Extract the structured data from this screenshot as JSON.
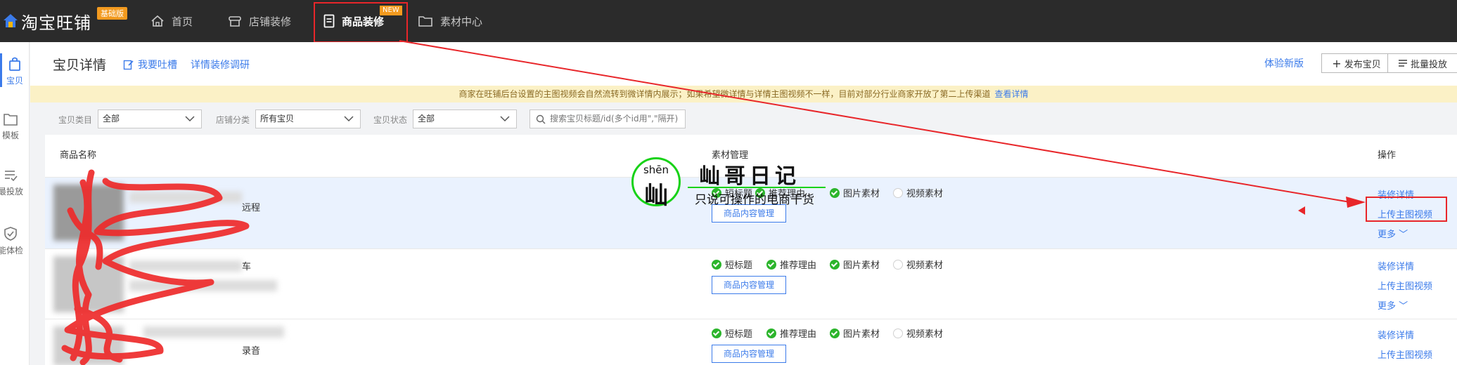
{
  "topnav": {
    "logo_text": "淘宝旺铺",
    "logo_badge": "基础版",
    "items": [
      {
        "label": "首页"
      },
      {
        "label": "店铺装修"
      },
      {
        "label": "商品装修",
        "badge": "NEW"
      },
      {
        "label": "素材中心"
      }
    ]
  },
  "leftrail": {
    "items": [
      {
        "label": "宝贝"
      },
      {
        "label": "模板"
      },
      {
        "label": "最投放"
      },
      {
        "label": "能体检"
      }
    ]
  },
  "header": {
    "title": "宝贝详情",
    "feedback_link": "我要吐槽",
    "survey_link": "详情装修调研",
    "try_new": "体验新版",
    "publish_btn": "发布宝贝",
    "batch_btn": "批量投放"
  },
  "notice": {
    "text": "商家在旺铺后台设置的主图视频会自然流转到微详情内展示；如果希望微详情与详情主图视频不一样，目前对部分行业商家开放了第二上传渠道",
    "link": "查看详情"
  },
  "filters": {
    "category_label": "宝贝类目",
    "category_value": "全部",
    "shop_category_label": "店铺分类",
    "shop_category_value": "所有宝贝",
    "status_label": "宝贝状态",
    "status_value": "全部",
    "search_placeholder": "搜索宝贝标题/id(多个id用\",\"隔开)"
  },
  "table": {
    "columns": {
      "name": "商品名称",
      "material": "素材管理",
      "ops": "操作"
    },
    "rows": [
      {
        "name_tail": "远程",
        "tags": [
          {
            "label": "短标题",
            "done": true
          },
          {
            "label": "推荐理由",
            "done": true
          },
          {
            "label": "图片素材",
            "done": true
          },
          {
            "label": "视频素材",
            "done": false
          }
        ],
        "manage_btn": "商品内容管理",
        "ops": [
          "装修详情",
          "上传主图视频",
          "更多"
        ]
      },
      {
        "name_tail": "车",
        "tags": [
          {
            "label": "短标题",
            "done": true
          },
          {
            "label": "推荐理由",
            "done": true
          },
          {
            "label": "图片素材",
            "done": true
          },
          {
            "label": "视频素材",
            "done": false
          }
        ],
        "manage_btn": "商品内容管理",
        "ops": [
          "装修详情",
          "上传主图视频",
          "更多"
        ]
      },
      {
        "name_tail": "录音",
        "tags": [
          {
            "label": "短标题",
            "done": true
          },
          {
            "label": "推荐理由",
            "done": true
          },
          {
            "label": "图片素材",
            "done": true
          },
          {
            "label": "视频素材",
            "done": false
          }
        ],
        "manage_btn": "商品内容管理",
        "ops": [
          "装修详情",
          "上传主图视频"
        ]
      }
    ]
  },
  "watermark": {
    "pinyin": "shēn",
    "char": "屾",
    "title": "屾哥日记",
    "subtitle": "只说可操作的电商干货"
  },
  "colors": {
    "topbar": "#2b2b2b",
    "accent": "#3b7bea",
    "check_green": "#2cb52c",
    "annotation_red": "#e8262a",
    "notice_bg": "#fbf1c6"
  }
}
